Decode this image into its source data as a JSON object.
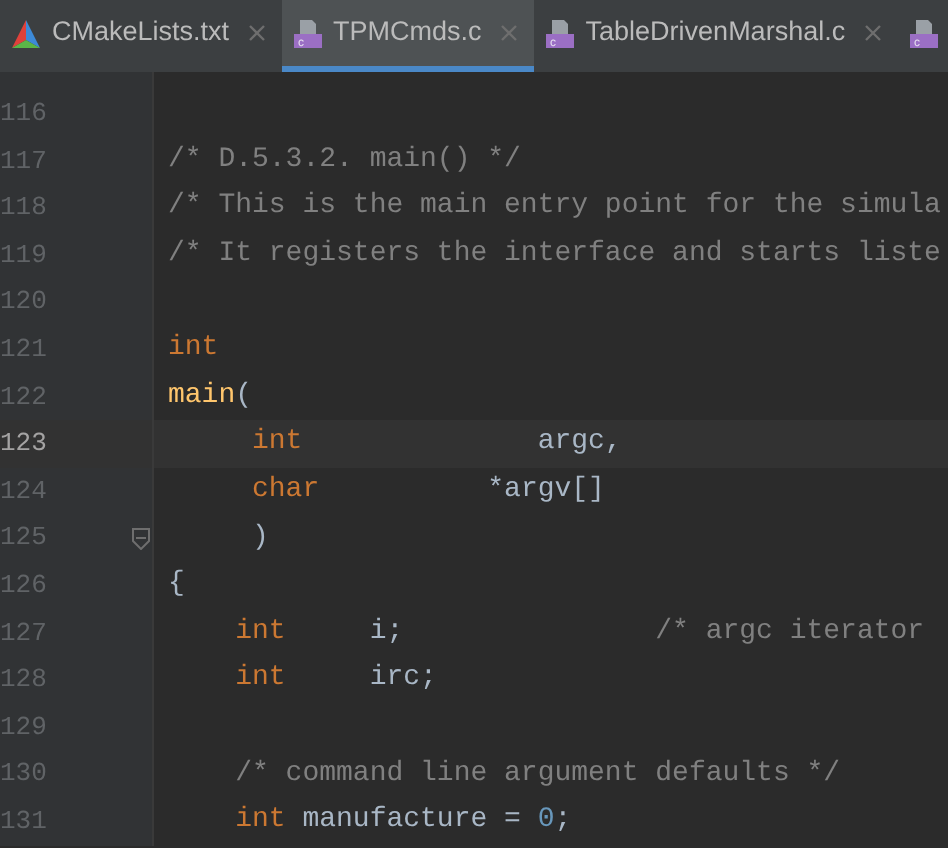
{
  "tabs": [
    {
      "label": "CMakeLists.txt",
      "kind": "cmake",
      "selected": false
    },
    {
      "label": "TPMCmds.c",
      "kind": "c",
      "selected": true
    },
    {
      "label": "TableDrivenMarshal.c",
      "kind": "c",
      "selected": false
    },
    {
      "kind": "c",
      "selected": false
    }
  ],
  "lines": [
    {
      "number": "116",
      "current": false,
      "fold": false
    },
    {
      "number": "117",
      "current": false,
      "fold": false,
      "tokens": [
        {
          "kind": "comment",
          "text": "/* D.5.3.2. main() */"
        }
      ]
    },
    {
      "number": "118",
      "current": false,
      "fold": false,
      "tokens": [
        {
          "kind": "comment",
          "text": "/* This is the main entry point for the simula"
        }
      ]
    },
    {
      "number": "119",
      "current": false,
      "fold": false,
      "tokens": [
        {
          "kind": "comment",
          "text": "/* It registers the interface and starts liste"
        }
      ]
    },
    {
      "number": "120",
      "current": false,
      "fold": false
    },
    {
      "number": "121",
      "current": false,
      "fold": false,
      "tokens": [
        {
          "kind": "keyword",
          "text": "int"
        }
      ]
    },
    {
      "number": "122",
      "current": false,
      "fold": false,
      "tokens": [
        {
          "kind": "function",
          "text": "main"
        },
        {
          "kind": "plain",
          "text": "("
        }
      ]
    },
    {
      "number": "123",
      "current": true,
      "fold": false,
      "tokens": [
        {
          "kind": "keyword",
          "text": "     int"
        },
        {
          "kind": "plain",
          "text": "              argc,"
        }
      ]
    },
    {
      "number": "124",
      "current": false,
      "fold": false,
      "tokens": [
        {
          "kind": "keyword",
          "text": "     char"
        },
        {
          "kind": "plain",
          "text": "          *argv[]"
        }
      ]
    },
    {
      "number": "125",
      "current": false,
      "fold": true,
      "tokens": [
        {
          "kind": "plain",
          "text": "     )"
        }
      ]
    },
    {
      "number": "126",
      "current": false,
      "fold": false,
      "tokens": [
        {
          "kind": "plain",
          "text": "{"
        }
      ]
    },
    {
      "number": "127",
      "current": false,
      "fold": false,
      "tokens": [
        {
          "kind": "keyword",
          "text": "    int"
        },
        {
          "kind": "plain",
          "text": "     i;"
        },
        {
          "kind": "comment",
          "text": "               /* argc iterator"
        }
      ]
    },
    {
      "number": "128",
      "current": false,
      "fold": false,
      "tokens": [
        {
          "kind": "keyword",
          "text": "    int"
        },
        {
          "kind": "plain",
          "text": "     irc;"
        }
      ]
    },
    {
      "number": "129",
      "current": false,
      "fold": false
    },
    {
      "number": "130",
      "current": false,
      "fold": false,
      "tokens": [
        {
          "kind": "comment",
          "text": "    /* command line argument defaults */"
        }
      ]
    },
    {
      "number": "131",
      "current": false,
      "fold": false,
      "tokens": [
        {
          "kind": "keyword",
          "text": "    int"
        },
        {
          "kind": "plain",
          "text": " manufacture = "
        },
        {
          "kind": "number",
          "text": "0"
        },
        {
          "kind": "plain",
          "text": ";"
        }
      ]
    }
  ]
}
